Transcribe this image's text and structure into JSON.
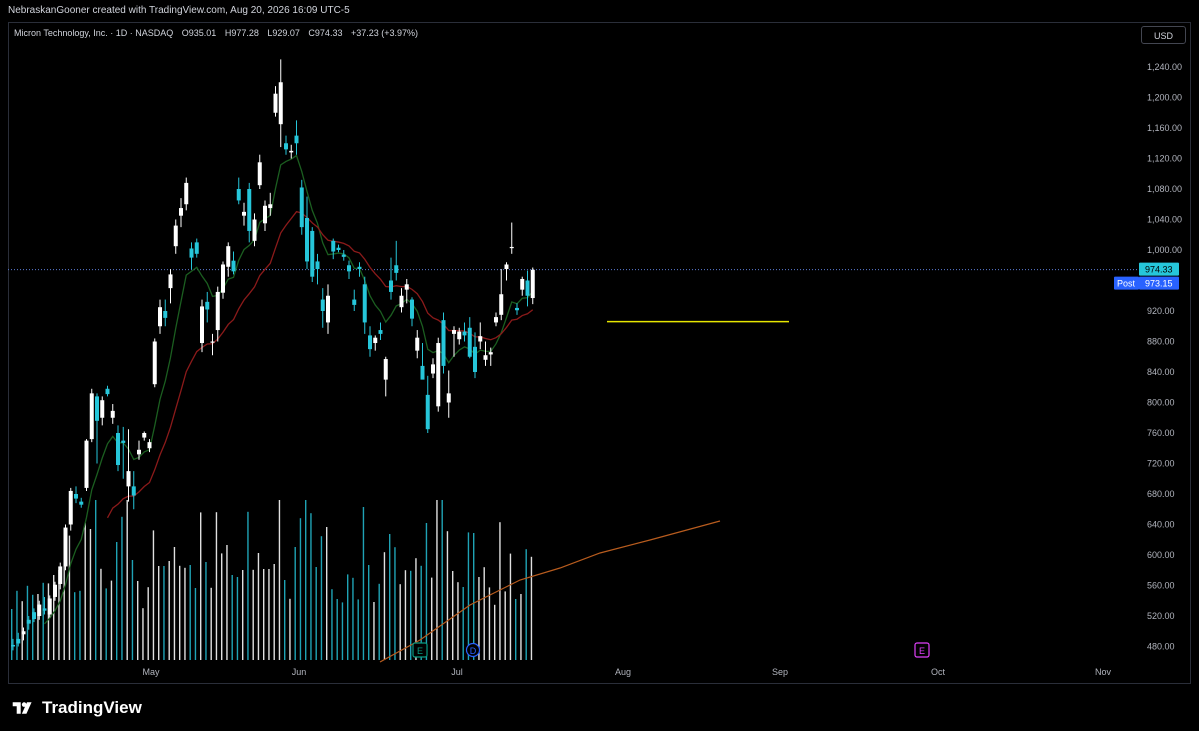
{
  "header": {
    "credit": "NebraskanGooner created with TradingView.com, Aug 20, 2026 16:09 UTC-5"
  },
  "legend": {
    "symbol": "Micron Technology, Inc. · 1D · NASDAQ",
    "open_label": "O",
    "open": "935.01",
    "high_label": "H",
    "high": "977.28",
    "low_label": "L",
    "low": "929.07",
    "close_label": "C",
    "close": "974.33",
    "change": "+37.23 (+3.97%)"
  },
  "currency": "USD",
  "brand": {
    "name": "TradingView",
    "icon": "tradingview-logo-icon"
  },
  "price_axis": {
    "ticks": [
      "1,240.00",
      "1,200.00",
      "1,160.00",
      "1,120.00",
      "1,080.00",
      "1,040.00",
      "1,000.00",
      "920.00",
      "880.00",
      "840.00",
      "800.00",
      "760.00",
      "720.00",
      "680.00",
      "640.00",
      "600.00",
      "560.00",
      "520.00",
      "480.00"
    ],
    "last_price": "974.33",
    "post_label": "Post",
    "post_price": "973.15"
  },
  "time_axis": {
    "labels": [
      "May",
      "Jun",
      "Jul",
      "Aug",
      "Sep",
      "Oct",
      "Nov"
    ]
  },
  "event_markers": [
    {
      "letter": "E",
      "color": "#089981"
    },
    {
      "letter": "D",
      "color": "#2962ff"
    },
    {
      "letter": "E",
      "color": "#e040fb"
    }
  ],
  "colors": {
    "up": "#ffffff",
    "down": "#26c6da",
    "ema_fast": "#1b5e20",
    "ema_slow": "#8b1a1a",
    "volume_ma": "#b85c1e",
    "support_line": "#e6e600",
    "last_price_line": "#5b7bd5",
    "post_badge": "#2962ff"
  },
  "chart_data": {
    "type": "candlestick",
    "symbol": "Micron Technology, Inc.",
    "interval": "1D",
    "exchange": "NASDAQ",
    "y_range": [
      460,
      1260
    ],
    "support_level": 906,
    "last_price": 974.33,
    "post_price": 973.15,
    "candles": [
      {
        "o": 482,
        "h": 490,
        "l": 475,
        "c": 480
      },
      {
        "o": 490,
        "h": 498,
        "l": 480,
        "c": 484
      },
      {
        "o": 496,
        "h": 505,
        "l": 488,
        "c": 500
      },
      {
        "o": 515,
        "h": 520,
        "l": 502,
        "c": 510
      },
      {
        "o": 525,
        "h": 530,
        "l": 512,
        "c": 516
      },
      {
        "o": 520,
        "h": 540,
        "l": 515,
        "c": 535
      },
      {
        "o": 530,
        "h": 545,
        "l": 522,
        "c": 527
      },
      {
        "o": 522,
        "h": 547,
        "l": 518,
        "c": 543
      },
      {
        "o": 545,
        "h": 565,
        "l": 540,
        "c": 561
      },
      {
        "o": 562,
        "h": 590,
        "l": 555,
        "c": 585
      },
      {
        "o": 585,
        "h": 640,
        "l": 580,
        "c": 636
      },
      {
        "o": 640,
        "h": 688,
        "l": 632,
        "c": 684
      },
      {
        "o": 680,
        "h": 690,
        "l": 668,
        "c": 674
      },
      {
        "o": 670,
        "h": 675,
        "l": 662,
        "c": 666
      },
      {
        "o": 688,
        "h": 752,
        "l": 684,
        "c": 750
      },
      {
        "o": 752,
        "h": 818,
        "l": 748,
        "c": 812
      },
      {
        "o": 808,
        "h": 812,
        "l": 720,
        "c": 776
      },
      {
        "o": 780,
        "h": 808,
        "l": 770,
        "c": 803
      },
      {
        "o": 818,
        "h": 822,
        "l": 808,
        "c": 811
      },
      {
        "o": 780,
        "h": 798,
        "l": 772,
        "c": 789
      },
      {
        "o": 760,
        "h": 770,
        "l": 710,
        "c": 718
      },
      {
        "o": 750,
        "h": 768,
        "l": 700,
        "c": 747
      },
      {
        "o": 690,
        "h": 765,
        "l": 670,
        "c": 710
      },
      {
        "o": 690,
        "h": 710,
        "l": 660,
        "c": 678
      },
      {
        "o": 732,
        "h": 750,
        "l": 725,
        "c": 738
      },
      {
        "o": 754,
        "h": 762,
        "l": 750,
        "c": 760
      },
      {
        "o": 740,
        "h": 752,
        "l": 735,
        "c": 748
      },
      {
        "o": 824,
        "h": 884,
        "l": 820,
        "c": 880
      },
      {
        "o": 900,
        "h": 935,
        "l": 890,
        "c": 925
      },
      {
        "o": 920,
        "h": 935,
        "l": 900,
        "c": 911
      },
      {
        "o": 950,
        "h": 975,
        "l": 930,
        "c": 968
      },
      {
        "o": 1005,
        "h": 1040,
        "l": 995,
        "c": 1032
      },
      {
        "o": 1045,
        "h": 1068,
        "l": 1030,
        "c": 1055
      },
      {
        "o": 1060,
        "h": 1095,
        "l": 1052,
        "c": 1088
      },
      {
        "o": 1002,
        "h": 1010,
        "l": 975,
        "c": 990
      },
      {
        "o": 1010,
        "h": 1015,
        "l": 990,
        "c": 995
      },
      {
        "o": 878,
        "h": 935,
        "l": 866,
        "c": 926
      },
      {
        "o": 932,
        "h": 945,
        "l": 905,
        "c": 922
      },
      {
        "o": 880,
        "h": 890,
        "l": 862,
        "c": 880
      },
      {
        "o": 895,
        "h": 952,
        "l": 880,
        "c": 945
      },
      {
        "o": 944,
        "h": 985,
        "l": 936,
        "c": 981
      },
      {
        "o": 978,
        "h": 1010,
        "l": 965,
        "c": 1005
      },
      {
        "o": 986,
        "h": 998,
        "l": 968,
        "c": 972
      },
      {
        "o": 1080,
        "h": 1095,
        "l": 1060,
        "c": 1065
      },
      {
        "o": 1045,
        "h": 1062,
        "l": 1032,
        "c": 1050
      },
      {
        "o": 1080,
        "h": 1088,
        "l": 1010,
        "c": 1025
      },
      {
        "o": 1012,
        "h": 1048,
        "l": 1005,
        "c": 1040
      },
      {
        "o": 1085,
        "h": 1125,
        "l": 1080,
        "c": 1115
      },
      {
        "o": 1035,
        "h": 1065,
        "l": 1025,
        "c": 1058
      },
      {
        "o": 1055,
        "h": 1075,
        "l": 1045,
        "c": 1060
      },
      {
        "o": 1180,
        "h": 1215,
        "l": 1175,
        "c": 1205
      },
      {
        "o": 1165,
        "h": 1250,
        "l": 1135,
        "c": 1220
      },
      {
        "o": 1140,
        "h": 1150,
        "l": 1125,
        "c": 1132
      },
      {
        "o": 1128,
        "h": 1138,
        "l": 1120,
        "c": 1130
      },
      {
        "o": 1150,
        "h": 1170,
        "l": 1125,
        "c": 1140
      },
      {
        "o": 1082,
        "h": 1092,
        "l": 1020,
        "c": 1030
      },
      {
        "o": 1042,
        "h": 1070,
        "l": 975,
        "c": 985
      },
      {
        "o": 1025,
        "h": 1030,
        "l": 958,
        "c": 965
      },
      {
        "o": 985,
        "h": 995,
        "l": 955,
        "c": 975
      },
      {
        "o": 935,
        "h": 950,
        "l": 898,
        "c": 920
      },
      {
        "o": 905,
        "h": 955,
        "l": 890,
        "c": 940
      },
      {
        "o": 1012,
        "h": 1015,
        "l": 988,
        "c": 998
      },
      {
        "o": 1003,
        "h": 1007,
        "l": 997,
        "c": 1000
      },
      {
        "o": 994,
        "h": 1000,
        "l": 986,
        "c": 991
      },
      {
        "o": 980,
        "h": 986,
        "l": 962,
        "c": 972
      },
      {
        "o": 935,
        "h": 948,
        "l": 920,
        "c": 928
      },
      {
        "o": 978,
        "h": 984,
        "l": 965,
        "c": 975
      },
      {
        "o": 955,
        "h": 965,
        "l": 890,
        "c": 905
      },
      {
        "o": 888,
        "h": 900,
        "l": 860,
        "c": 870
      },
      {
        "o": 878,
        "h": 888,
        "l": 868,
        "c": 885
      },
      {
        "o": 895,
        "h": 905,
        "l": 882,
        "c": 890
      },
      {
        "o": 830,
        "h": 860,
        "l": 808,
        "c": 857
      },
      {
        "o": 960,
        "h": 990,
        "l": 935,
        "c": 945
      },
      {
        "o": 980,
        "h": 1012,
        "l": 960,
        "c": 970
      },
      {
        "o": 925,
        "h": 950,
        "l": 918,
        "c": 940
      },
      {
        "o": 948,
        "h": 962,
        "l": 930,
        "c": 955
      },
      {
        "o": 935,
        "h": 938,
        "l": 900,
        "c": 910
      },
      {
        "o": 868,
        "h": 895,
        "l": 858,
        "c": 885
      },
      {
        "o": 848,
        "h": 878,
        "l": 840,
        "c": 830
      },
      {
        "o": 810,
        "h": 835,
        "l": 760,
        "c": 765
      },
      {
        "o": 838,
        "h": 858,
        "l": 832,
        "c": 850
      },
      {
        "o": 795,
        "h": 885,
        "l": 788,
        "c": 878
      },
      {
        "o": 908,
        "h": 918,
        "l": 838,
        "c": 848
      },
      {
        "o": 800,
        "h": 842,
        "l": 780,
        "c": 812
      },
      {
        "o": 890,
        "h": 900,
        "l": 860,
        "c": 895
      },
      {
        "o": 883,
        "h": 898,
        "l": 876,
        "c": 893
      },
      {
        "o": 893,
        "h": 905,
        "l": 880,
        "c": 888
      },
      {
        "o": 898,
        "h": 912,
        "l": 858,
        "c": 860
      },
      {
        "o": 873,
        "h": 892,
        "l": 832,
        "c": 840
      },
      {
        "o": 880,
        "h": 905,
        "l": 870,
        "c": 887
      },
      {
        "o": 856,
        "h": 880,
        "l": 848,
        "c": 862
      },
      {
        "o": 863,
        "h": 872,
        "l": 848,
        "c": 866
      },
      {
        "o": 905,
        "h": 918,
        "l": 900,
        "c": 912
      },
      {
        "o": 915,
        "h": 975,
        "l": 908,
        "c": 942
      },
      {
        "o": 975,
        "h": 984,
        "l": 960,
        "c": 981
      },
      {
        "o": 1003,
        "h": 1036,
        "l": 995,
        "c": 1004
      },
      {
        "o": 924,
        "h": 930,
        "l": 915,
        "c": 921
      },
      {
        "o": 948,
        "h": 965,
        "l": 940,
        "c": 962
      },
      {
        "o": 960,
        "h": 973,
        "l": 926,
        "c": 940
      },
      {
        "o": 937,
        "h": 977,
        "l": 929,
        "c": 974
      }
    ]
  }
}
